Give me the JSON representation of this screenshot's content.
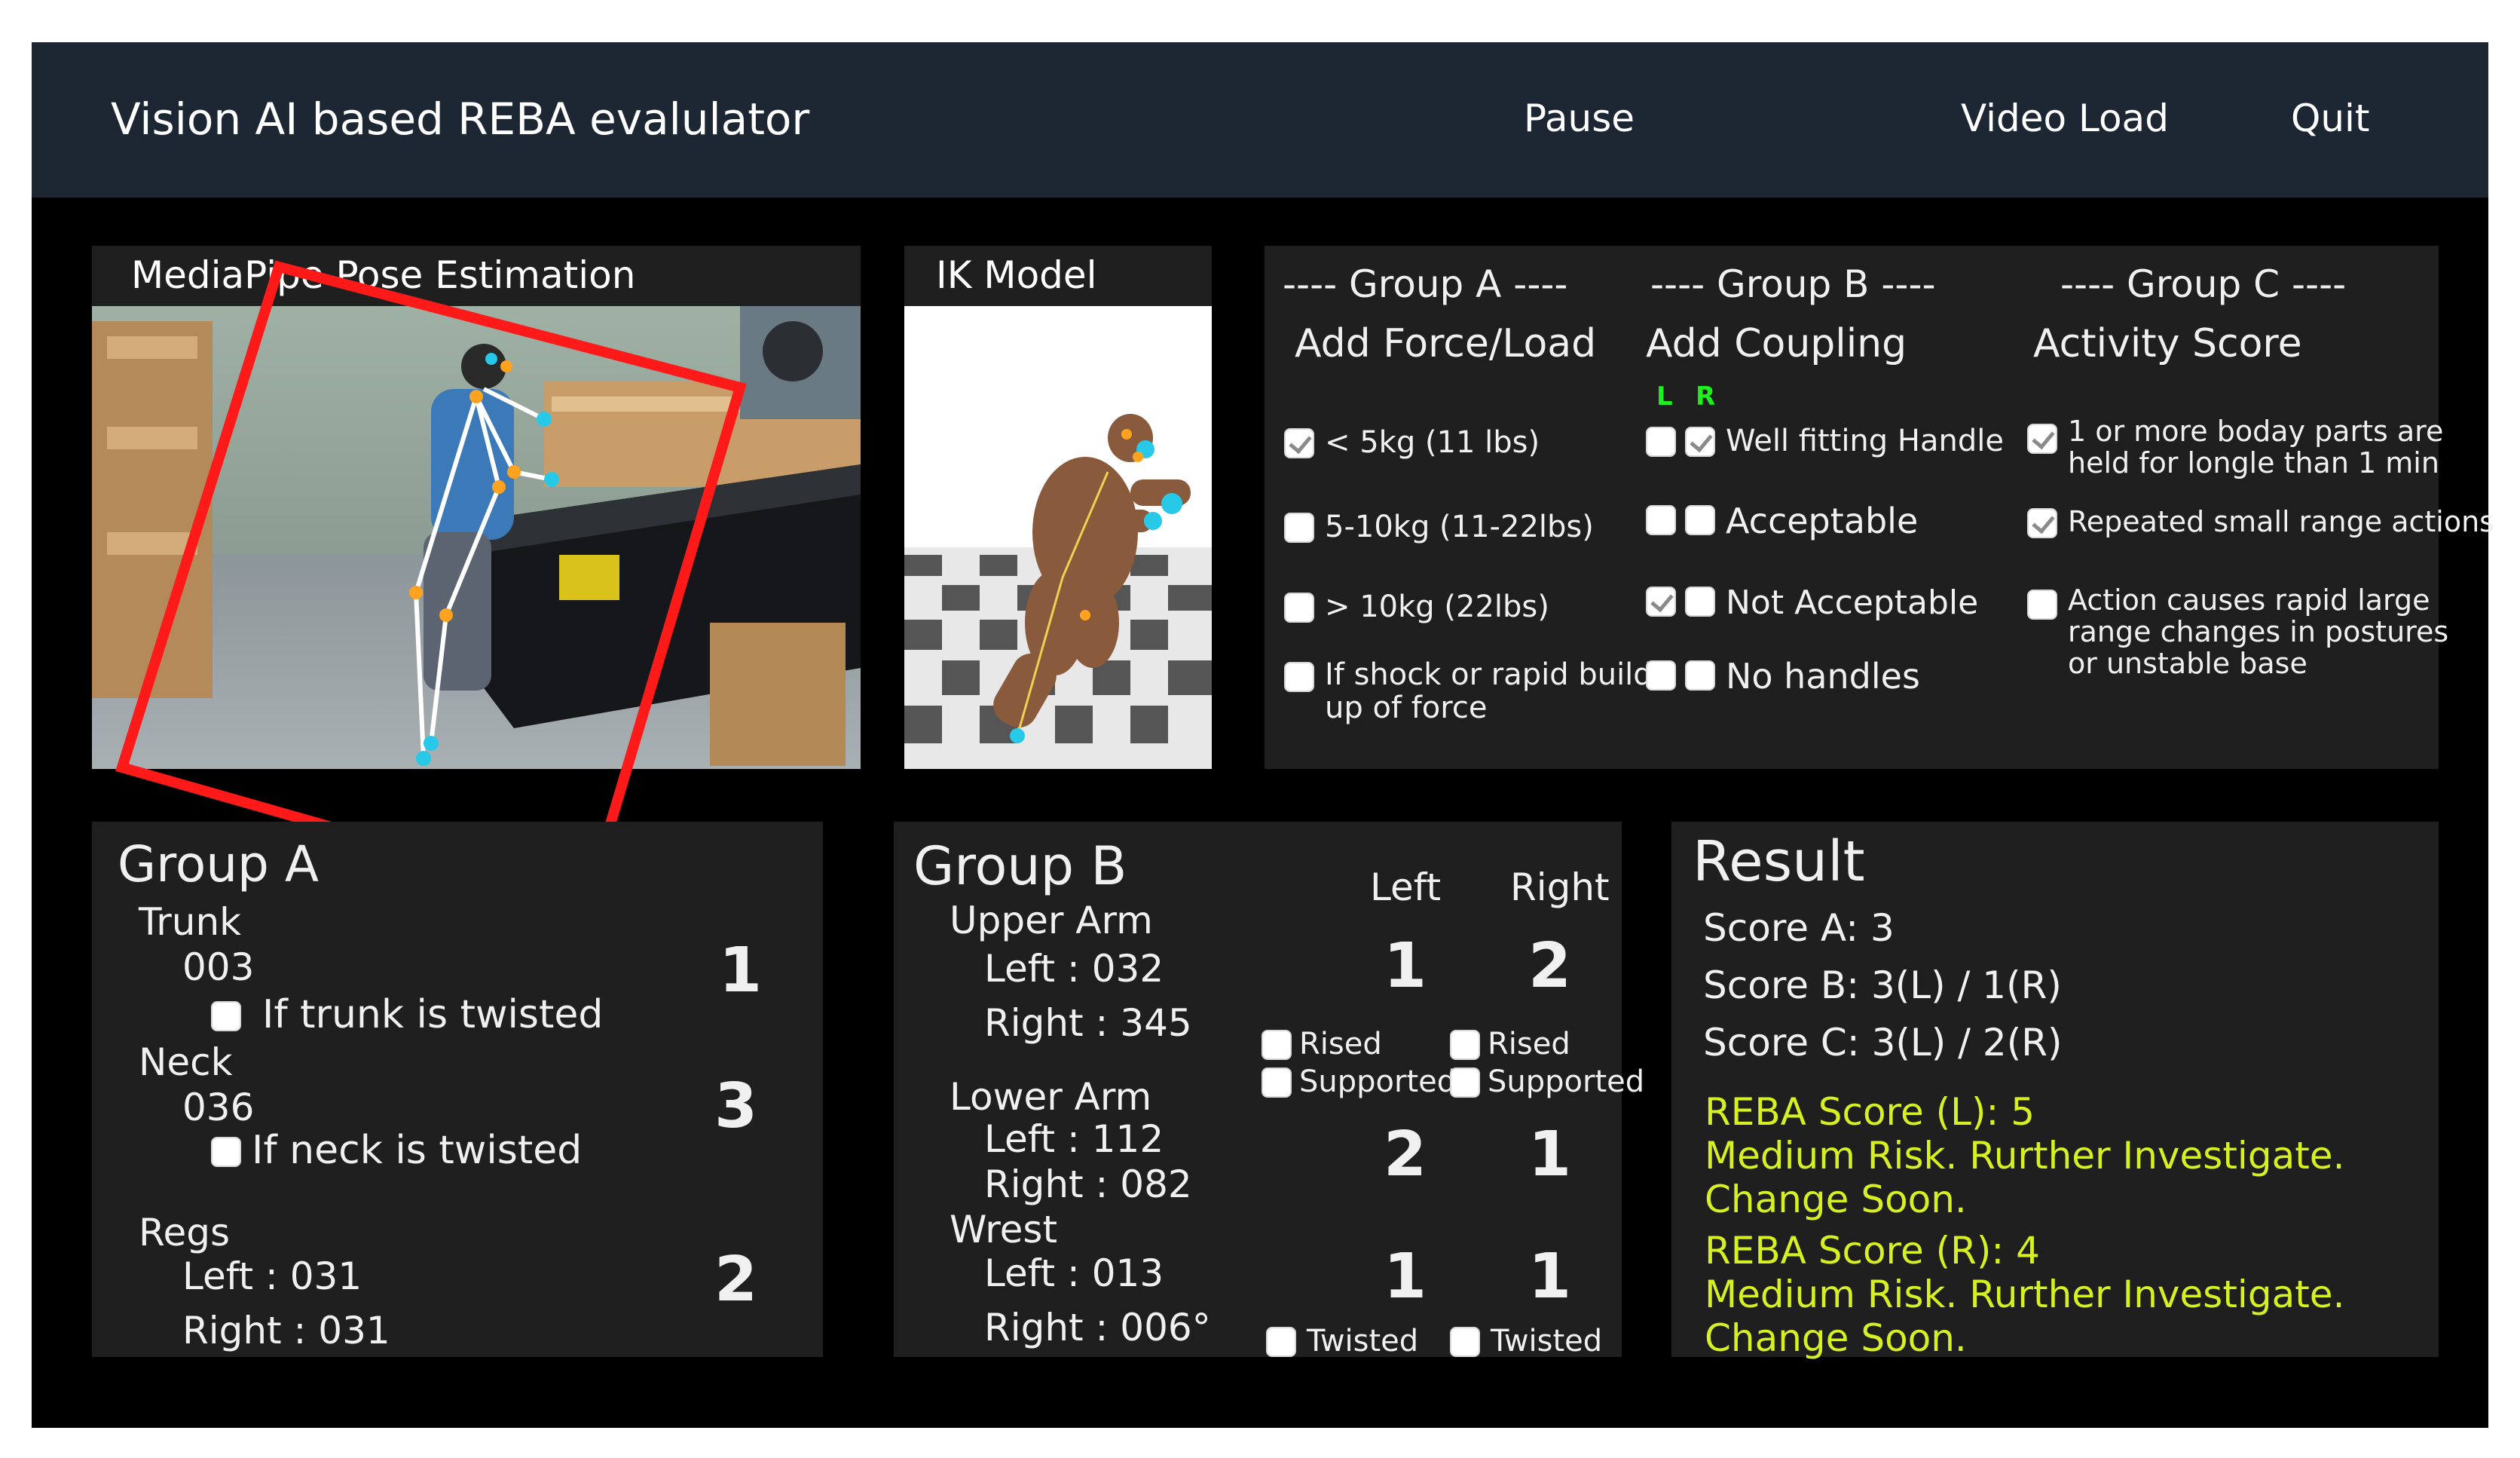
{
  "header": {
    "title": "Vision AI based REBA evalulator",
    "pause_label": "Pause",
    "video_load_label": "Video Load",
    "quit_label": "Quit"
  },
  "pose_panel": {
    "title": "MediaPipe Pose Estimation"
  },
  "ik_panel": {
    "title": "IK Model"
  },
  "options": {
    "group_a": {
      "heading": "---- Group A ----",
      "subheading": "Add Force/Load",
      "items": [
        {
          "label": "< 5kg (11 lbs)",
          "checked": true
        },
        {
          "label": "5-10kg (11-22lbs)",
          "checked": false
        },
        {
          "label": "> 10kg (22lbs)",
          "checked": false
        },
        {
          "label": "If shock or rapid build",
          "label2": "up of force",
          "checked": false
        }
      ]
    },
    "group_b": {
      "heading": "---- Group B ----",
      "subheading": "Add Coupling",
      "l_label": "L",
      "r_label": "R",
      "items": [
        {
          "label": "Well fitting Handle",
          "left": false,
          "right": true
        },
        {
          "label": "Acceptable",
          "left": false,
          "right": false
        },
        {
          "label": "Not Acceptable",
          "left": true,
          "right": false
        },
        {
          "label": "No handles",
          "left": false,
          "right": false
        }
      ]
    },
    "group_c": {
      "heading": "---- Group C ----",
      "subheading": "Activity Score",
      "items": [
        {
          "label": "1 or more boday parts are",
          "label2": "held for longle than 1 min",
          "label3": "",
          "checked": true
        },
        {
          "label": "Repeated small range actions",
          "label2": "",
          "label3": "",
          "checked": true
        },
        {
          "label": "Action causes rapid large",
          "label2": "range changes in postures",
          "label3": "or unstable base",
          "checked": false
        }
      ]
    }
  },
  "group_a_panel": {
    "title": "Group A",
    "trunk_label": "Trunk",
    "trunk_value": "003",
    "trunk_twist_label": "If trunk is twisted",
    "trunk_score": "1",
    "neck_label": "Neck",
    "neck_value": "036",
    "neck_twist_label": "If neck is twisted",
    "neck_score": "3",
    "legs_label": "Regs",
    "legs_left": "Left : 031",
    "legs_right": "Right : 031",
    "legs_score": "2"
  },
  "group_b_panel": {
    "title": "Group B",
    "left_header": "Left",
    "right_header": "Right",
    "upper_arm_label": "Upper Arm",
    "upper_arm_left": "Left : 032",
    "upper_arm_right": "Right : 345",
    "upper_arm_score_left": "1",
    "upper_arm_score_right": "2",
    "rised_label": "Rised",
    "supported_label": "Supported",
    "lower_arm_label": "Lower Arm",
    "lower_arm_left": "Left : 112",
    "lower_arm_right": "Right : 082",
    "lower_arm_score_left": "2",
    "lower_arm_score_right": "1",
    "wrist_label": "Wrest",
    "wrist_left": "Left : 013",
    "wrist_right": "Right : 006°",
    "wrist_score_left": "1",
    "wrist_score_right": "1",
    "twisted_label": "Twisted"
  },
  "result_panel": {
    "title": "Result",
    "score_a": "Score A:  3",
    "score_b": "Score B:  3(L) / 1(R)",
    "score_c": "Score C: 3(L) / 2(R)",
    "reba_left": "REBA Score (L): 5",
    "reba_left_risk": "Medium Risk. Rurther Investigate.",
    "reba_left_action": "Change Soon.",
    "reba_right": "REBA Score (R): 4",
    "reba_right_risk": "Medium Risk. Rurther Investigate.",
    "reba_right_action": "Change Soon."
  },
  "colors": {
    "accent_cyan": "#2ed3c9",
    "score_green": "#1ef01e",
    "warning_yellow": "#d6f022",
    "titlebar": "#1d2733",
    "panel": "#1f1f1f",
    "bbox_red": "#ff1a1a"
  }
}
